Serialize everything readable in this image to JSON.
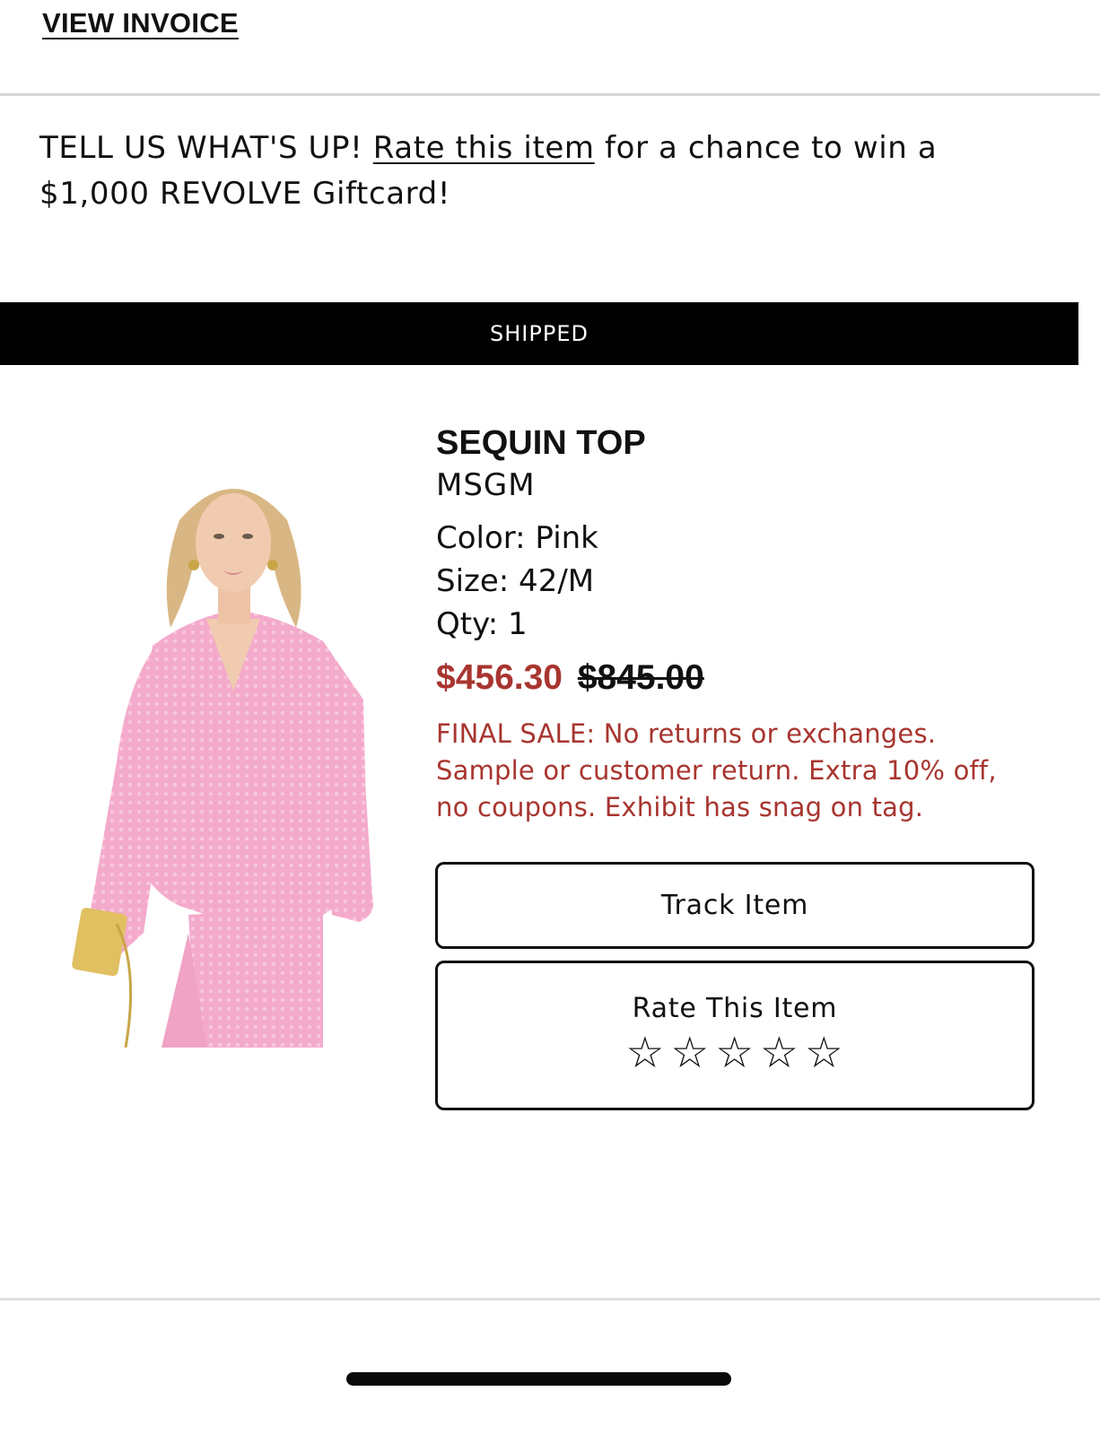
{
  "header": {
    "view_invoice_label": "VIEW INVOICE"
  },
  "promo": {
    "prefix": "TELL US WHAT'S UP!",
    "link_label": "Rate this item",
    "suffix": "for a chance to win a $1,000 REVOLVE Giftcard!"
  },
  "status": {
    "label": "SHIPPED"
  },
  "product": {
    "image_icon": "product-photo-pink-sequin-shirt",
    "name": "SEQUIN TOP",
    "brand": "MSGM",
    "color": "Color: Pink",
    "size": "Size: 42/M",
    "qty": "Qty: 1",
    "sale_price": "$456.30",
    "original_price": "$845.00",
    "final_sale_note": "FINAL SALE: No returns or exchanges. Sample or customer return. Extra 10% off, no coupons. Exhibit has snag on tag."
  },
  "actions": {
    "track_label": "Track Item",
    "rate_label": "Rate This Item",
    "stars": [
      "☆",
      "☆",
      "☆",
      "☆",
      "☆"
    ],
    "rating": 0
  },
  "colors": {
    "sale_red": "#a8352f",
    "status_bar": "#000000",
    "product_pink": "#f3a9c9"
  }
}
